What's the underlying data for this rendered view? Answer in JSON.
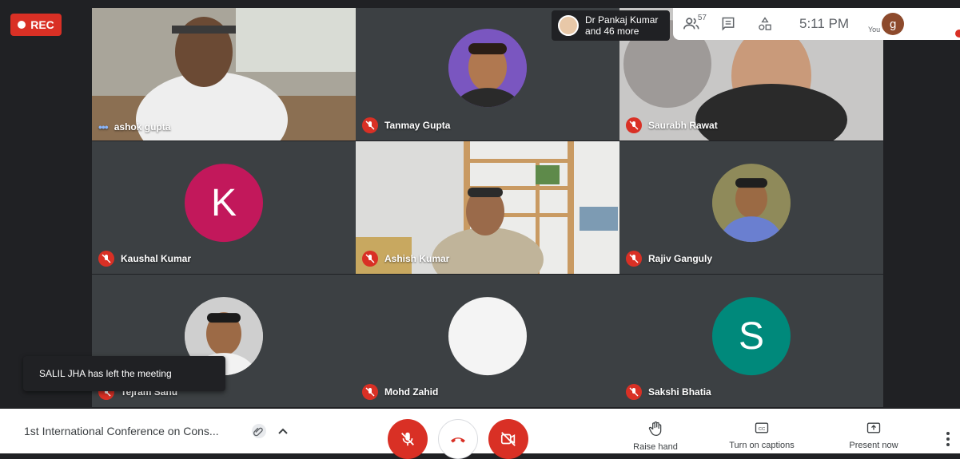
{
  "recording": {
    "label": "REC"
  },
  "presenter_chip": {
    "line1": "Dr Pankaj Kumar",
    "line2": "and 46 more"
  },
  "topbar": {
    "participant_count": "57",
    "time": "5:11 PM",
    "you_label": "You",
    "user_initial": "g"
  },
  "participants": [
    {
      "name": "ashok gupta",
      "state": "speaking",
      "type": "video"
    },
    {
      "name": "Tanmay Gupta",
      "state": "muted",
      "type": "photo"
    },
    {
      "name": "Saurabh Rawat",
      "state": "muted",
      "type": "video"
    },
    {
      "name": "Kaushal Kumar",
      "state": "muted",
      "type": "initial",
      "initial": "K",
      "color": "#c2185b"
    },
    {
      "name": "Ashish Kumar",
      "state": "muted",
      "type": "video"
    },
    {
      "name": "Rajiv Ganguly",
      "state": "muted",
      "type": "photo"
    },
    {
      "name": "Tejram Sahu",
      "state": "muted",
      "type": "photo"
    },
    {
      "name": "Mohd Zahid",
      "state": "muted",
      "type": "photo"
    },
    {
      "name": "Sakshi Bhatia",
      "state": "muted",
      "type": "initial",
      "initial": "S",
      "color": "#00897b"
    }
  ],
  "toast": {
    "text": "SALIL JHA has left the meeting"
  },
  "bottom": {
    "meeting_title": "1st International Conference on Cons...",
    "raise_hand": "Raise hand",
    "captions": "Turn on captions",
    "present": "Present now"
  },
  "colors": {
    "red": "#d93025",
    "dark": "#202124",
    "tile": "#3c4043"
  }
}
